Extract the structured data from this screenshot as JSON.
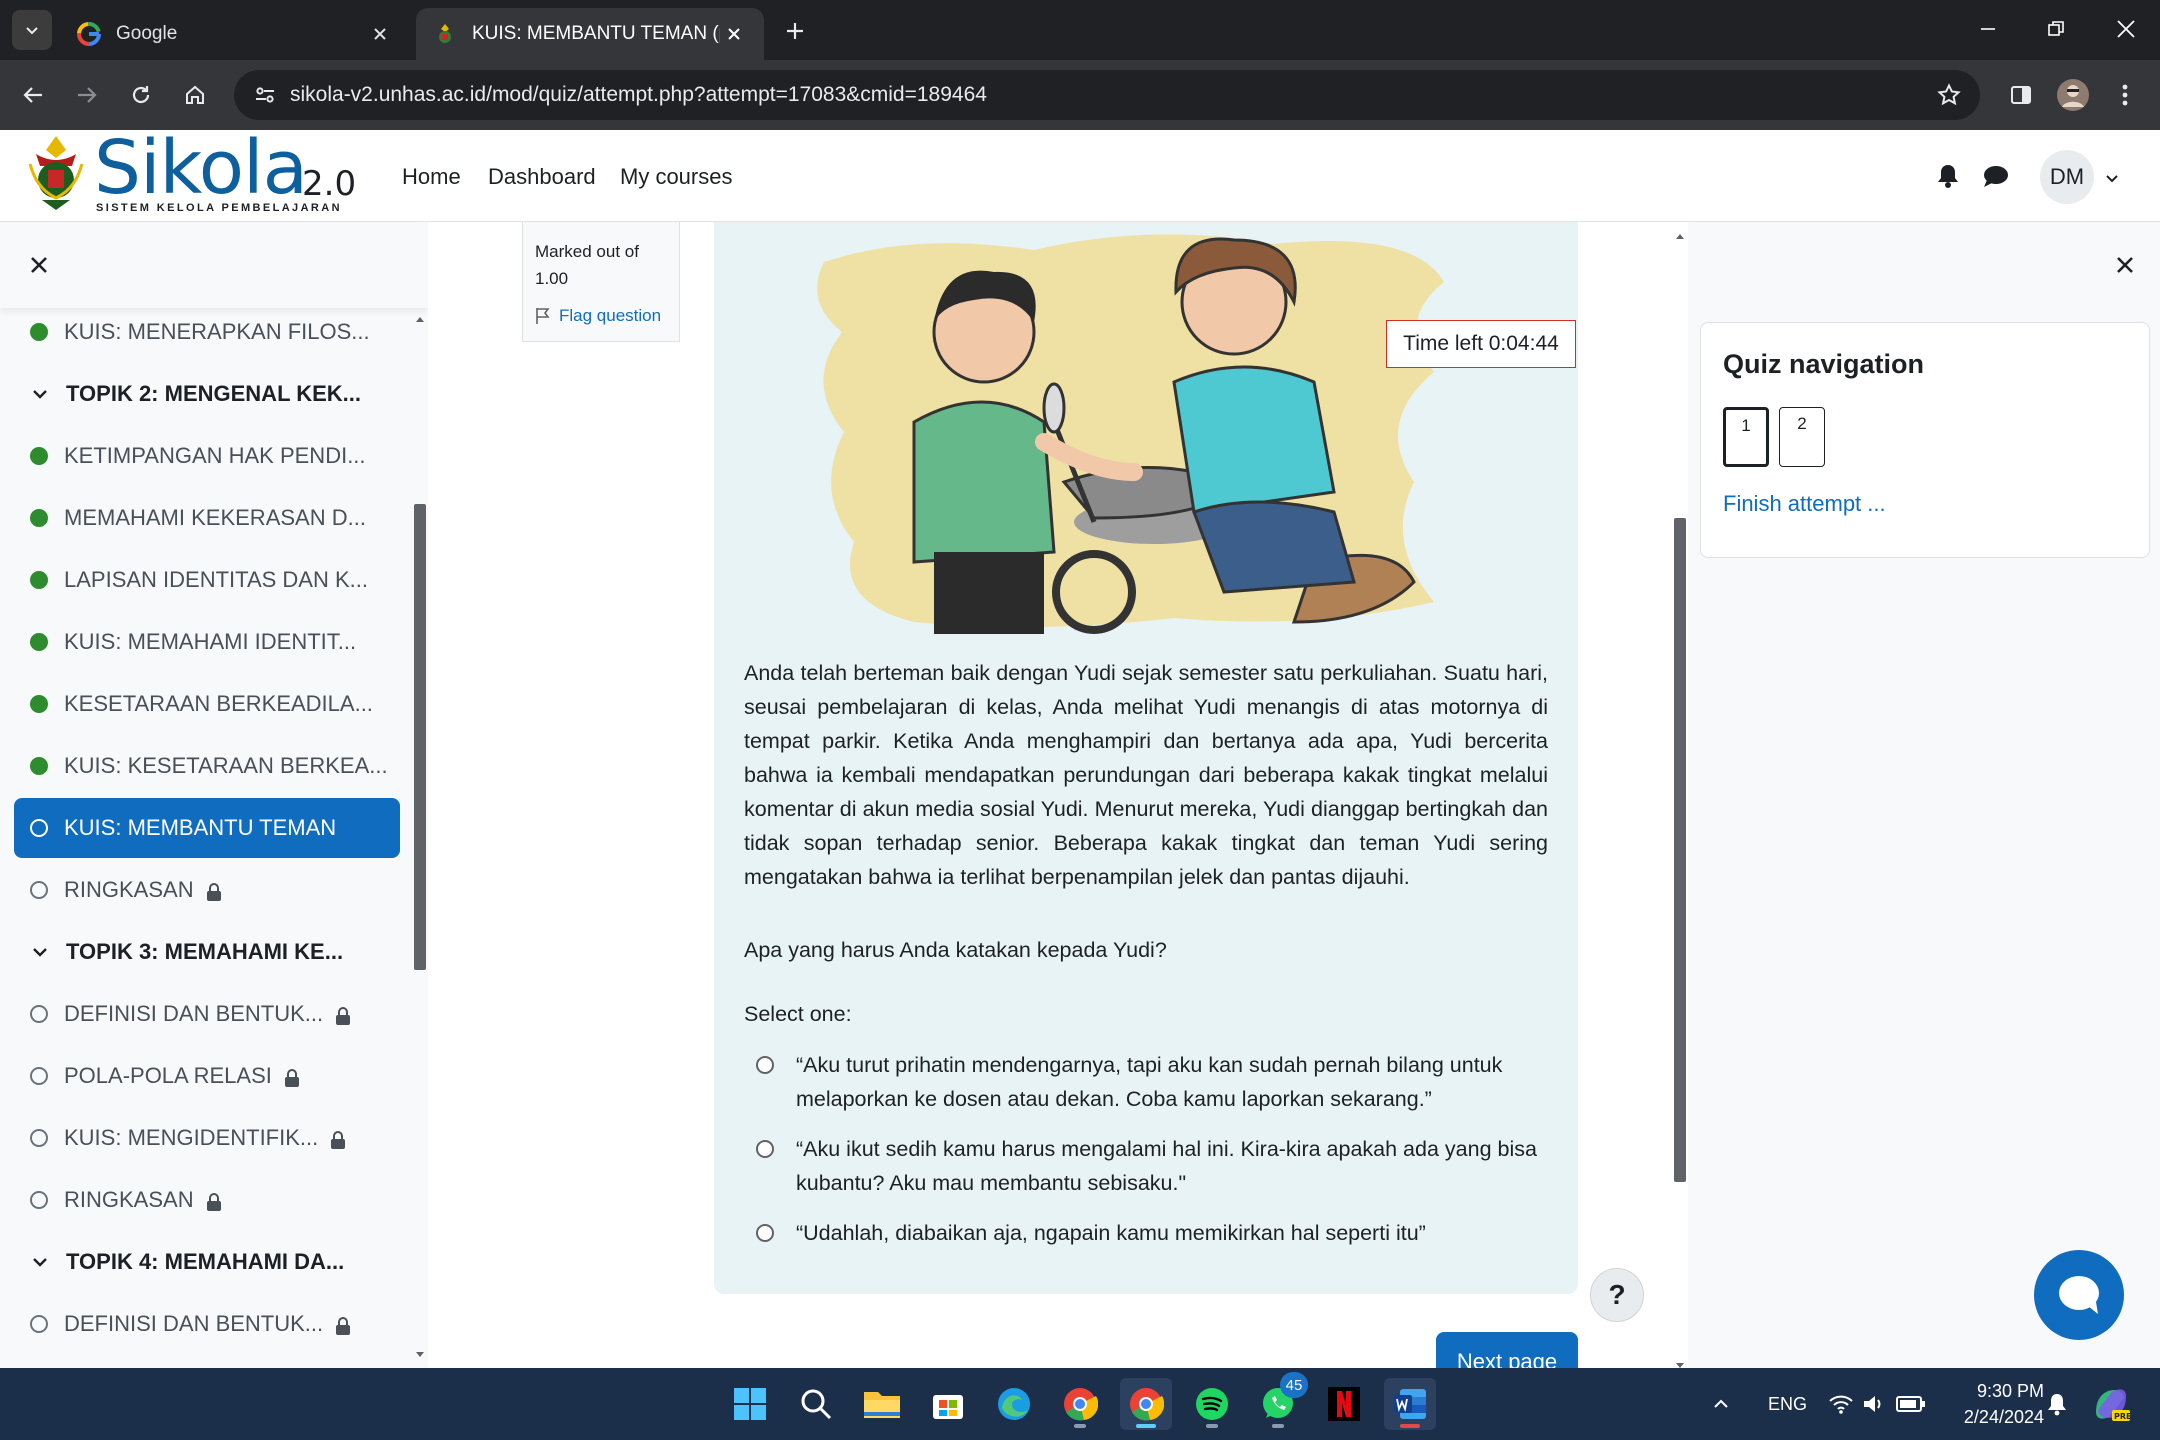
{
  "browser": {
    "tabs": [
      {
        "title": "Google",
        "active": false
      },
      {
        "title": "KUIS: MEMBANTU TEMAN (pag",
        "active": true
      }
    ],
    "url": "sikola-v2.unhas.ac.id/mod/quiz/attempt.php?attempt=17083&cmid=189464"
  },
  "site": {
    "logo_text": "Sikola",
    "logo_version": "2.0",
    "logo_subtitle": "SISTEM KELOLA PEMBELAJARAN",
    "nav": [
      "Home",
      "Dashboard",
      "My courses"
    ],
    "user_initials": "DM"
  },
  "course_index": [
    {
      "label": "KUIS: MENERAPKAN FILOS...",
      "type": "item",
      "status": "done"
    },
    {
      "label": "TOPIK 2: MENGENAL KEK...",
      "type": "section"
    },
    {
      "label": "KETIMPANGAN HAK PENDI...",
      "type": "item",
      "status": "done"
    },
    {
      "label": "MEMAHAMI KEKERASAN D...",
      "type": "item",
      "status": "done"
    },
    {
      "label": "LAPISAN IDENTITAS DAN K...",
      "type": "item",
      "status": "done"
    },
    {
      "label": "KUIS: MEMAHAMI IDENTIT...",
      "type": "item",
      "status": "done"
    },
    {
      "label": "KESETARAAN BERKEADILA...",
      "type": "item",
      "status": "done"
    },
    {
      "label": "KUIS: KESETARAAN BERKEA...",
      "type": "item",
      "status": "done"
    },
    {
      "label": "KUIS: MEMBANTU TEMAN",
      "type": "item",
      "status": "open",
      "current": true
    },
    {
      "label": "RINGKASAN",
      "type": "item",
      "status": "open",
      "locked": true
    },
    {
      "label": "TOPIK 3: MEMAHAMI KE...",
      "type": "section"
    },
    {
      "label": "DEFINISI DAN BENTUK...",
      "type": "item",
      "status": "open",
      "locked": true
    },
    {
      "label": "POLA-POLA RELASI",
      "type": "item",
      "status": "open",
      "locked": true
    },
    {
      "label": "KUIS: MENGIDENTIFIK...",
      "type": "item",
      "status": "open",
      "locked": true
    },
    {
      "label": "RINGKASAN",
      "type": "item",
      "status": "open",
      "locked": true
    },
    {
      "label": "TOPIK 4: MEMAHAMI DA...",
      "type": "section"
    },
    {
      "label": "DEFINISI DAN BENTUK...",
      "type": "item",
      "status": "open",
      "locked": true
    }
  ],
  "question_info": {
    "marked_out_of": "Marked out of 1.00",
    "flag_label": "Flag question"
  },
  "timer": "Time left 0:04:44",
  "question": {
    "text": "Anda telah berteman baik dengan Yudi sejak semester satu perkuliahan. Suatu hari, seusai pembelajaran di kelas, Anda melihat Yudi menangis di atas motornya di tempat parkir. Ketika Anda menghampiri dan bertanya ada apa, Yudi bercerita bahwa ia kembali mendapatkan perundungan dari  beberapa kakak tingkat melalui komentar di akun media sosial Yudi. Menurut mereka, Yudi dianggap bertingkah dan tidak sopan terhadap senior. Beberapa kakak tingkat dan teman Yudi sering mengatakan bahwa ia terlihat berpenampilan jelek dan pantas dijauhi.",
    "prompt": "Apa yang harus Anda katakan kepada Yudi?",
    "select_label": "Select one:",
    "answers": [
      "“Aku turut prihatin mendengarnya, tapi aku kan sudah pernah bilang untuk melaporkan ke dosen atau dekan. Coba kamu laporkan sekarang.”",
      "“Aku ikut sedih kamu harus mengalami hal ini. Kira-kira apakah ada yang bisa kubantu? Aku mau membantu sebisaku.\"",
      "“Udahlah, diabaikan aja, ngapain kamu memikirkan hal seperti itu”"
    ]
  },
  "next_page_label": "Next page",
  "help_label": "?",
  "quiz_nav": {
    "title": "Quiz navigation",
    "questions": [
      "1",
      "2"
    ],
    "current": "1",
    "finish_label": "Finish attempt ..."
  },
  "taskbar": {
    "whatsapp_badge": "45",
    "language": "ENG",
    "time": "9:30 PM",
    "date": "2/24/2024"
  },
  "colors": {
    "accent": "#0f6cbf",
    "done": "#2e8b2e",
    "timer_border": "#ca3120",
    "question_bg": "#e7f3f5"
  }
}
